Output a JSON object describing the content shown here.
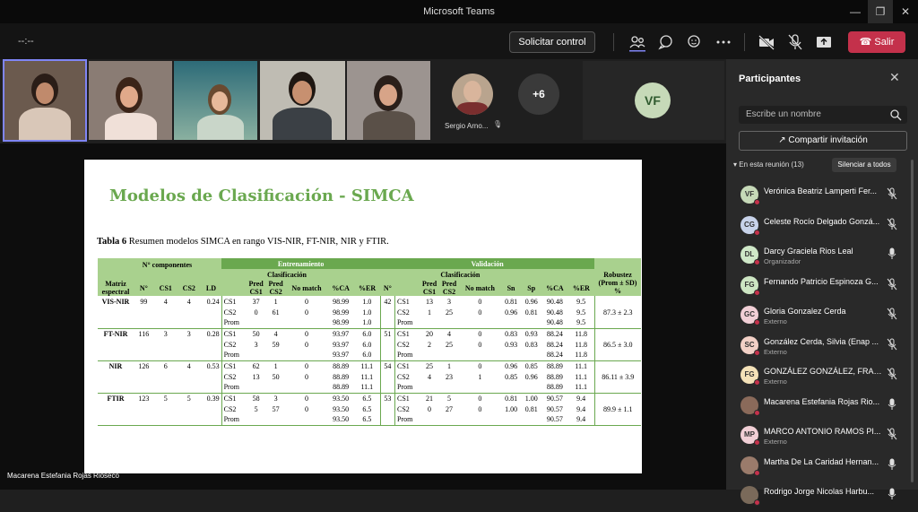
{
  "window": {
    "title": "Microsoft Teams"
  },
  "toolbar": {
    "timer": "--:--",
    "request_control": "Solicitar control",
    "leave": "Salir"
  },
  "gallery": {
    "tiles": [
      {
        "type": "video"
      },
      {
        "type": "video"
      },
      {
        "type": "video"
      },
      {
        "type": "video"
      },
      {
        "type": "video"
      },
      {
        "type": "avatar",
        "name": "Sergio Arno..."
      },
      {
        "type": "overflow",
        "label": "+6"
      },
      {
        "type": "initials",
        "label": "VF"
      }
    ]
  },
  "slide": {
    "title": "Modelos de Clasificación - SIMCA",
    "caption_bold": "Tabla 6",
    "caption_rest": " Resumen modelos SIMCA en rango VIS-NIR, FT-NIR, NIR y FTIR.",
    "table": {
      "h_n_comp": "N° componentes",
      "h_train": "Entrenamiento",
      "h_valid": "Validación",
      "h_clasif": "Clasificación",
      "h_matriz": "Matriz espectral",
      "h_n": "N°",
      "h_cs1": "CS1",
      "h_cs2": "CS2",
      "h_ld": "LD",
      "h_pred_cs1": "Pred CS1",
      "h_pred_cs2": "Pred CS2",
      "h_nomatch": "No match",
      "h_pca": "%CA",
      "h_per": "%ER",
      "h_sn": "Sn",
      "h_sp": "Sp",
      "h_rob": "Robustez (Prom ± SD) %",
      "groups": [
        {
          "matrix": "VIS-NIR",
          "n": "99",
          "cs1": "4",
          "cs2": "4",
          "ld": "0.24",
          "vn": "42",
          "rob": "87.3 ± 2.3",
          "rows": [
            {
              "t": [
                "CS1",
                "37",
                "1",
                "0",
                "98.99",
                "1.0"
              ],
              "v": [
                "CS1",
                "13",
                "3",
                "0",
                "0.81",
                "0.96",
                "90.48",
                "9.5"
              ]
            },
            {
              "t": [
                "CS2",
                "0",
                "61",
                "0",
                "98.99",
                "1.0"
              ],
              "v": [
                "CS2",
                "1",
                "25",
                "0",
                "0.96",
                "0.81",
                "90.48",
                "9.5"
              ]
            },
            {
              "t": [
                "Prom",
                "",
                "",
                "",
                "98.99",
                "1.0"
              ],
              "v": [
                "Prom",
                "",
                "",
                "",
                "",
                "",
                "90.48",
                "9.5"
              ]
            }
          ]
        },
        {
          "matrix": "FT-NIR",
          "n": "116",
          "cs1": "3",
          "cs2": "3",
          "ld": "0.28",
          "vn": "51",
          "rob": "86.5 ± 3.0",
          "rows": [
            {
              "t": [
                "CS1",
                "50",
                "4",
                "0",
                "93.97",
                "6.0"
              ],
              "v": [
                "CS1",
                "20",
                "4",
                "0",
                "0.83",
                "0.93",
                "88.24",
                "11.8"
              ]
            },
            {
              "t": [
                "CS2",
                "3",
                "59",
                "0",
                "93.97",
                "6.0"
              ],
              "v": [
                "CS2",
                "2",
                "25",
                "0",
                "0.93",
                "0.83",
                "88.24",
                "11.8"
              ]
            },
            {
              "t": [
                "Prom",
                "",
                "",
                "",
                "93.97",
                "6.0"
              ],
              "v": [
                "Prom",
                "",
                "",
                "",
                "",
                "",
                "88.24",
                "11.8"
              ]
            }
          ]
        },
        {
          "matrix": "NIR",
          "n": "126",
          "cs1": "6",
          "cs2": "4",
          "ld": "0.53",
          "vn": "54",
          "rob": "86.11 ± 3.9",
          "rows": [
            {
              "t": [
                "CS1",
                "62",
                "1",
                "0",
                "88.89",
                "11.1"
              ],
              "v": [
                "CS1",
                "25",
                "1",
                "0",
                "0.96",
                "0.85",
                "88.89",
                "11.1"
              ]
            },
            {
              "t": [
                "CS2",
                "13",
                "50",
                "0",
                "88.89",
                "11.1"
              ],
              "v": [
                "CS2",
                "4",
                "23",
                "1",
                "0.85",
                "0.96",
                "88.89",
                "11.1"
              ]
            },
            {
              "t": [
                "Prom",
                "",
                "",
                "",
                "88.89",
                "11.1"
              ],
              "v": [
                "Prom",
                "",
                "",
                "",
                "",
                "",
                "88.89",
                "11.1"
              ]
            }
          ]
        },
        {
          "matrix": "FTIR",
          "n": "123",
          "cs1": "5",
          "cs2": "5",
          "ld": "0.39",
          "vn": "53",
          "rob": "89.9 ± 1.1",
          "rows": [
            {
              "t": [
                "CS1",
                "58",
                "3",
                "0",
                "93.50",
                "6.5"
              ],
              "v": [
                "CS1",
                "21",
                "5",
                "0",
                "0.81",
                "1.00",
                "90.57",
                "9.4"
              ]
            },
            {
              "t": [
                "CS2",
                "5",
                "57",
                "0",
                "93.50",
                "6.5"
              ],
              "v": [
                "CS2",
                "0",
                "27",
                "0",
                "1.00",
                "0.81",
                "90.57",
                "9.4"
              ]
            },
            {
              "t": [
                "Prom",
                "",
                "",
                "",
                "93.50",
                "6.5"
              ],
              "v": [
                "Prom",
                "",
                "",
                "",
                "",
                "",
                "90.57",
                "9.4"
              ]
            }
          ]
        }
      ]
    }
  },
  "presenter_name": "Macarena Estefania Rojas Rioseco",
  "panel": {
    "title": "Participantes",
    "search_placeholder": "Escribe un nombre",
    "invite": "Compartir invitación",
    "in_meeting": "En esta reunión (13)",
    "mute_all": "Silenciar a todos",
    "participants": [
      {
        "initials": "VF",
        "name": "Verónica Beatriz Lamperti Fer...",
        "sub": "",
        "mic": "muted",
        "color": "#c6d9b8"
      },
      {
        "initials": "CG",
        "name": "Celeste Rocío Delgado Gonzá...",
        "sub": "",
        "mic": "muted",
        "color": "#c8d3ea"
      },
      {
        "initials": "DL",
        "name": "Darcy Graciela Rios Leal",
        "sub": "Organizador",
        "mic": "on",
        "color": "#cfe8c8"
      },
      {
        "initials": "FG",
        "name": "Fernando Patricio Espinoza G...",
        "sub": "",
        "mic": "muted",
        "color": "#cde6c3"
      },
      {
        "initials": "GC",
        "name": "Gloria Gonzalez Cerda",
        "sub": "Externo",
        "mic": "muted",
        "color": "#f1cfd6"
      },
      {
        "initials": "SC",
        "name": "González Cerda, Silvia (Enap ...",
        "sub": "Externo",
        "mic": "muted",
        "color": "#f3d1c7"
      },
      {
        "initials": "FG",
        "name": "GONZÁLEZ GONZÁLEZ, FRAN...",
        "sub": "Externo",
        "mic": "muted",
        "color": "#f4e2b8"
      },
      {
        "initials": "",
        "name": "Macarena Estefania Rojas Rio...",
        "sub": "",
        "mic": "on",
        "color": "#8a6a5a"
      },
      {
        "initials": "MP",
        "name": "MARCO ANTONIO RAMOS PI...",
        "sub": "Externo",
        "mic": "muted",
        "color": "#f1cfd6"
      },
      {
        "initials": "",
        "name": "Martha De La Caridad Hernan...",
        "sub": "",
        "mic": "on",
        "color": "#9a7b6b"
      },
      {
        "initials": "",
        "name": "Rodrigo Jorge Nicolas Harbu...",
        "sub": "",
        "mic": "on",
        "color": "#7a6a5a"
      }
    ]
  }
}
